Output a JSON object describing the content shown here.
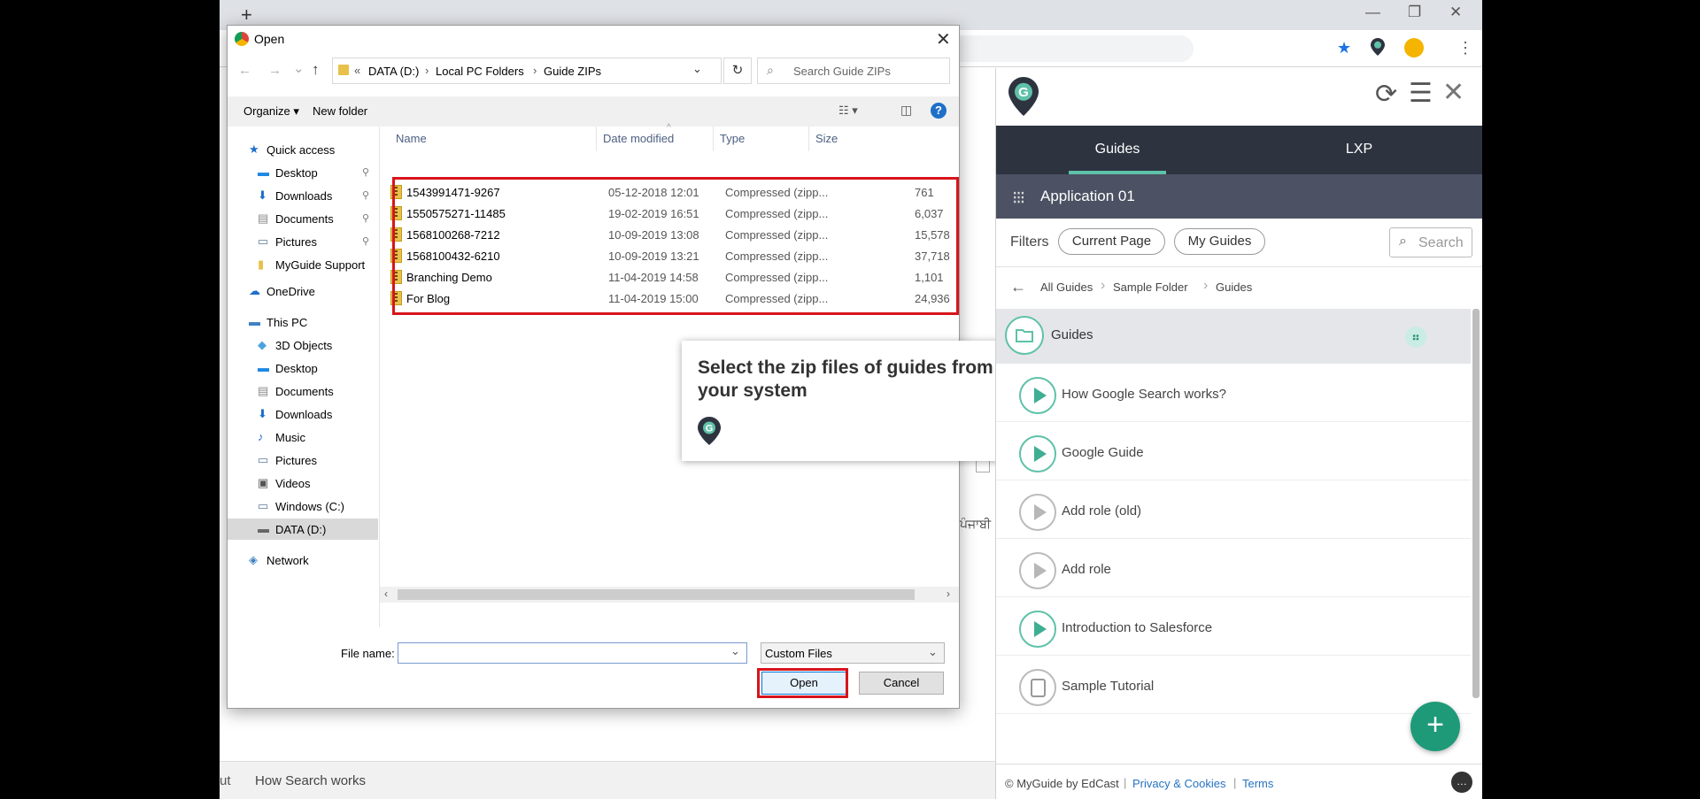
{
  "browser": {
    "new_tab_icon": "+",
    "window_buttons": [
      "—",
      "❐",
      "✕"
    ],
    "toolbar_icons": [
      "star-icon",
      "pin-icon",
      "account-icon",
      "more-icon"
    ],
    "accent_color": "#1a73e8"
  },
  "page_behind": {
    "bottom_left_fragment": "ut",
    "bottom_link": "How Search works",
    "text_fragment": "ਪੰਜਾਬੀ"
  },
  "dialog": {
    "title": "Open",
    "close_icon": "✕",
    "nav": {
      "back": "←",
      "forward": "→",
      "recent": "⌄",
      "up": "↑"
    },
    "address": {
      "overflow": "«",
      "crumbs": [
        "DATA (D:)",
        "Local PC Folders",
        "Guide ZIPs"
      ],
      "separator": "›",
      "dropdown": "⌄",
      "refresh": "↻"
    },
    "search": {
      "icon": "⌕",
      "placeholder": "Search Guide ZIPs"
    },
    "commands": {
      "organize": "Organize ▾",
      "new_folder": "New folder",
      "view_icon": "☷ ▾",
      "preview_icon": "◫",
      "help_icon": "?"
    },
    "nav_pane": [
      {
        "label": "Quick access",
        "icon": "★",
        "color": "#1e6fc8",
        "pinned": false,
        "selected": false
      },
      {
        "label": "Desktop",
        "icon": "▬",
        "color": "#1e88e5",
        "pinned": true,
        "selected": false
      },
      {
        "label": "Downloads",
        "icon": "⬇",
        "color": "#1e6fc8",
        "pinned": true,
        "selected": false
      },
      {
        "label": "Documents",
        "icon": "▤",
        "color": "#888888",
        "pinned": true,
        "selected": false
      },
      {
        "label": "Pictures",
        "icon": "▭",
        "color": "#5d7a9a",
        "pinned": true,
        "selected": false
      },
      {
        "label": "MyGuide Support",
        "icon": "▮",
        "color": "#e8c14a",
        "pinned": false,
        "selected": false
      },
      {
        "label": "OneDrive",
        "icon": "☁",
        "color": "#1e6fc8",
        "pinned": false,
        "selected": false
      },
      {
        "label": "This PC",
        "icon": "▬",
        "color": "#3c7fc1",
        "pinned": false,
        "selected": false
      },
      {
        "label": "3D Objects",
        "icon": "◆",
        "color": "#4aa3df",
        "pinned": false,
        "selected": false
      },
      {
        "label": "Desktop",
        "icon": "▬",
        "color": "#1e88e5",
        "pinned": false,
        "selected": false
      },
      {
        "label": "Documents",
        "icon": "▤",
        "color": "#888888",
        "pinned": false,
        "selected": false
      },
      {
        "label": "Downloads",
        "icon": "⬇",
        "color": "#1e6fc8",
        "pinned": false,
        "selected": false
      },
      {
        "label": "Music",
        "icon": "♪",
        "color": "#1e6fc8",
        "pinned": false,
        "selected": false
      },
      {
        "label": "Pictures",
        "icon": "▭",
        "color": "#5d7a9a",
        "pinned": false,
        "selected": false
      },
      {
        "label": "Videos",
        "icon": "▣",
        "color": "#555555",
        "pinned": false,
        "selected": false
      },
      {
        "label": "Windows (C:)",
        "icon": "▭",
        "color": "#5d7a9a",
        "pinned": false,
        "selected": false
      },
      {
        "label": "DATA (D:)",
        "icon": "▬",
        "color": "#666666",
        "pinned": false,
        "selected": true
      },
      {
        "label": "Network",
        "icon": "◈",
        "color": "#3c7fc1",
        "pinned": false,
        "selected": false
      }
    ],
    "columns": [
      "Name",
      "Date modified",
      "Type",
      "Size"
    ],
    "files": [
      {
        "name": "1543991471-9267",
        "date": "05-12-2018 12:01",
        "type": "Compressed (zipp...",
        "size": "761"
      },
      {
        "name": "1550575271-11485",
        "date": "19-02-2019 16:51",
        "type": "Compressed (zipp...",
        "size": "6,037"
      },
      {
        "name": "1568100268-7212",
        "date": "10-09-2019 13:08",
        "type": "Compressed (zipp...",
        "size": "15,578"
      },
      {
        "name": "1568100432-6210",
        "date": "10-09-2019 13:21",
        "type": "Compressed (zipp...",
        "size": "37,718"
      },
      {
        "name": "Branching Demo",
        "date": "11-04-2019 14:58",
        "type": "Compressed (zipp...",
        "size": "1,101"
      },
      {
        "name": "For Blog",
        "date": "11-04-2019 15:00",
        "type": "Compressed (zipp...",
        "size": "24,936"
      }
    ],
    "file_name_label": "File name:",
    "file_name_value": "",
    "file_type": "Custom Files",
    "open_label": "Open",
    "cancel_label": "Cancel",
    "highlight_color": "#d8141b"
  },
  "tooltip": {
    "text": "Select the zip files of guides from your system"
  },
  "panel": {
    "logo_letter": "G",
    "header_icons": {
      "refresh": "⟳",
      "menu": "☰",
      "close": "✕"
    },
    "tabs": [
      "Guides",
      "LXP"
    ],
    "active_tab": "Guides",
    "app_name": "Application 01",
    "filters_label": "Filters",
    "filter_chips": [
      "Current Page",
      "My Guides"
    ],
    "search_label": "Search",
    "breadcrumbs": [
      "All Guides",
      "Sample Folder",
      "Guides"
    ],
    "folder": "Guides",
    "guides": [
      {
        "title": "How Google Search works?",
        "style": "green"
      },
      {
        "title": "Google Guide",
        "style": "green"
      },
      {
        "title": "Add role (old)",
        "style": "gray"
      },
      {
        "title": "Add role",
        "style": "gray"
      },
      {
        "title": "Introduction to Salesforce",
        "style": "green"
      },
      {
        "title": "Sample Tutorial",
        "style": "doc"
      }
    ],
    "fab_label": "+",
    "footer": {
      "copyright": "© MyGuide by EdCast",
      "privacy": "Privacy & Cookies",
      "terms": "Terms",
      "separator": "|"
    },
    "accent_color": "#5fc1a8",
    "tab_bar_color": "#2d333f"
  }
}
